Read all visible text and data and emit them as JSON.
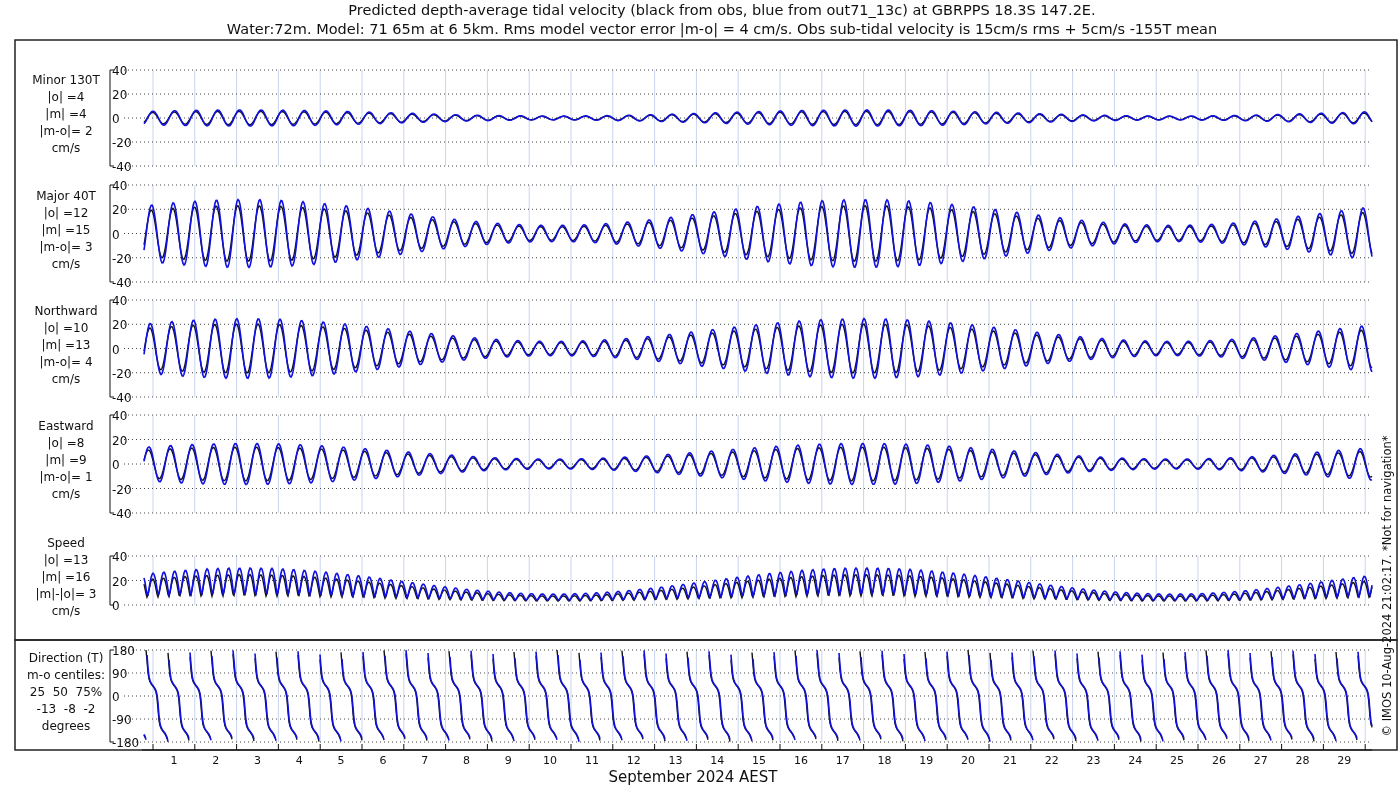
{
  "title": [
    "Predicted depth-average tidal velocity (black from obs, blue from out71_13c) at GBRPPS 18.3S 147.2E.",
    "Water:72m. Model: 71 65m at 6 5km. Rms model vector error |m-o| = 4 cm/s. Obs sub-tidal velocity is 15cm/s rms + 5cm/s -155T mean"
  ],
  "panels": [
    {
      "kind": "component",
      "label": [
        "Minor 130T",
        "|o| =4",
        "|m| =4",
        "|m-o|= 2",
        "cm/s"
      ],
      "yticks": [
        "40",
        "20",
        "0",
        "-20",
        "-40"
      ]
    },
    {
      "kind": "component",
      "label": [
        "Major 40T",
        "|o| =12",
        "|m| =15",
        "|m-o|= 3",
        "cm/s"
      ],
      "yticks": [
        "40",
        "20",
        "0",
        "-20",
        "-40"
      ]
    },
    {
      "kind": "component",
      "label": [
        "Northward",
        "|o| =10",
        "|m| =13",
        "|m-o|= 4",
        "cm/s"
      ],
      "yticks": [
        "40",
        "20",
        "0",
        "-20",
        "-40"
      ]
    },
    {
      "kind": "component",
      "label": [
        "Eastward",
        "|o| =8",
        "|m| =9",
        "|m-o|= 1",
        "cm/s"
      ],
      "yticks": [
        "40",
        "20",
        "0",
        "-20",
        "-40"
      ]
    },
    {
      "kind": "speed",
      "label": [
        "Speed",
        "|o| =13",
        "|m| =16",
        "|m|-|o|= 3",
        "cm/s"
      ],
      "yticks": [
        "40",
        "20",
        "0"
      ]
    },
    {
      "kind": "direction",
      "label": [
        "Direction (T)",
        "m-o centiles:",
        "25  50  75%",
        "-13  -8  -2",
        "degrees"
      ],
      "yticks": [
        "180",
        "90",
        "0",
        "-90",
        "-180"
      ]
    }
  ],
  "xticks": [
    "1",
    "2",
    "3",
    "4",
    "5",
    "6",
    "7",
    "8",
    "9",
    "10",
    "11",
    "12",
    "13",
    "14",
    "15",
    "16",
    "17",
    "18",
    "19",
    "20",
    "21",
    "22",
    "23",
    "24",
    "25",
    "26",
    "27",
    "28",
    "29"
  ],
  "xlabel": "September 2024 AEST",
  "footer": "© IMOS 10-Aug-2024 21:02:17. *Not for navigation*"
}
